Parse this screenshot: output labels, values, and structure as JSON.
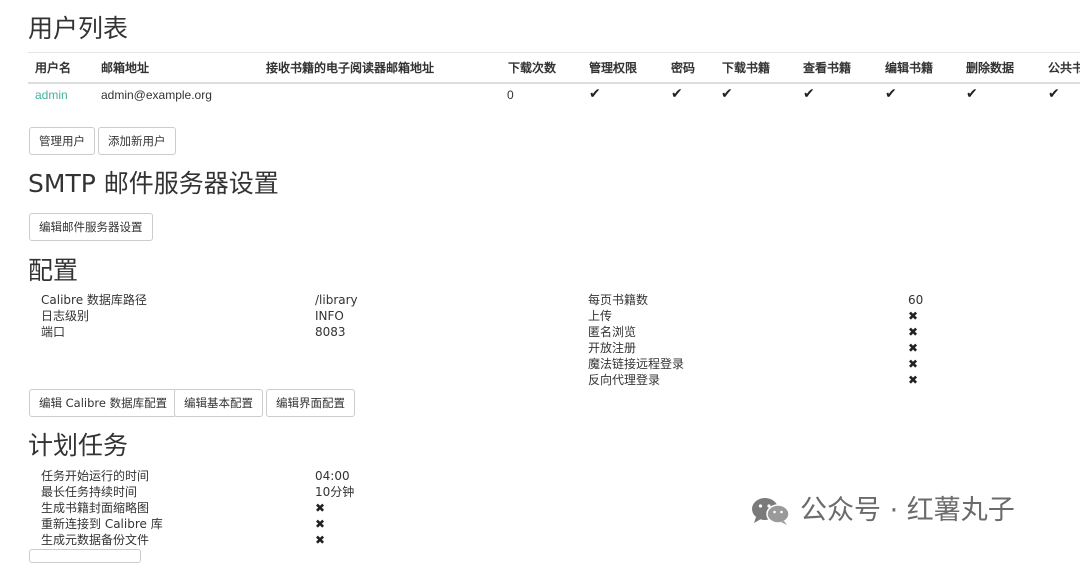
{
  "users": {
    "heading": "用户列表",
    "columns": [
      "用户名",
      "邮箱地址",
      "接收书籍的电子阅读器邮箱地址",
      "下载次数",
      "管理权限",
      "密码",
      "下载书籍",
      "查看书籍",
      "编辑书籍",
      "删除数据",
      "公共书"
    ],
    "rows": [
      {
        "username": "admin",
        "email": "admin@example.org",
        "ereader_email": "",
        "downloads": "0",
        "admin": "✔",
        "password": "✔",
        "download": "✔",
        "view": "✔",
        "edit": "✔",
        "delete": "✔",
        "public": "✔"
      }
    ],
    "buttons": {
      "manage": "管理用户",
      "add": "添加新用户"
    }
  },
  "smtp": {
    "heading": "SMTP 邮件服务器设置",
    "edit_button": "编辑邮件服务器设置"
  },
  "config": {
    "heading": "配置",
    "left": [
      {
        "label": "Calibre 数据库路径",
        "value": "/library"
      },
      {
        "label": "日志级别",
        "value": "INFO"
      },
      {
        "label": "端口",
        "value": "8083"
      }
    ],
    "right": [
      {
        "label": "每页书籍数",
        "value": "60"
      },
      {
        "label": "上传",
        "value": "✖"
      },
      {
        "label": "匿名浏览",
        "value": "✖"
      },
      {
        "label": "开放注册",
        "value": "✖"
      },
      {
        "label": "魔法链接远程登录",
        "value": "✖"
      },
      {
        "label": "反向代理登录",
        "value": "✖"
      }
    ],
    "buttons": {
      "db": "编辑 Calibre 数据库配置",
      "basic": "编辑基本配置",
      "ui": "编辑界面配置"
    }
  },
  "tasks": {
    "heading": "计划任务",
    "rows": [
      {
        "label": "任务开始运行的时间",
        "value": "04:00"
      },
      {
        "label": "最长任务持续时间",
        "value": "10分钟"
      },
      {
        "label": "生成书籍封面缩略图",
        "value": "✖"
      },
      {
        "label": "重新连接到 Calibre 库",
        "value": "✖"
      },
      {
        "label": "生成元数据备份文件",
        "value": "✖"
      }
    ]
  },
  "watermark": {
    "text": "公众号 · 红薯丸子",
    "icon": "wechat-icon"
  },
  "colors": {
    "link": "#45b29d",
    "border": "#cccccc",
    "text": "#333333"
  }
}
